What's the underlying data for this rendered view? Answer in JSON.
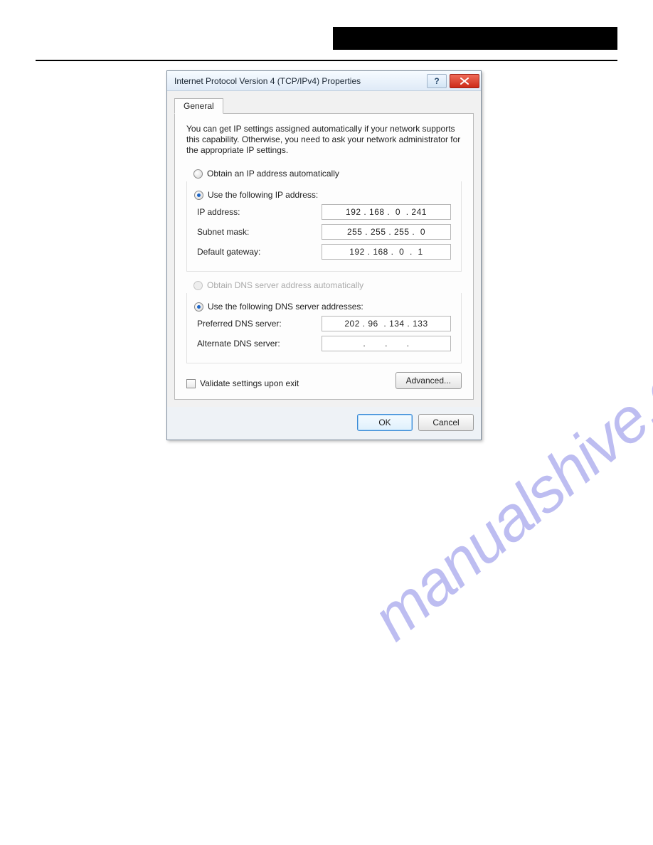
{
  "dialog": {
    "title": "Internet Protocol Version 4 (TCP/IPv4) Properties",
    "tab": "General",
    "intro": "You can get IP settings assigned automatically if your network supports this capability. Otherwise, you need to ask your network administrator for the appropriate IP settings.",
    "ip_section": {
      "auto_label": "Obtain an IP address automatically",
      "manual_label": "Use the following IP address:",
      "fields": {
        "ip_label": "IP address:",
        "ip_value": "192 . 168 .  0  . 241",
        "mask_label": "Subnet mask:",
        "mask_value": "255 . 255 . 255 .  0",
        "gw_label": "Default gateway:",
        "gw_value": "192 . 168 .  0  .  1"
      }
    },
    "dns_section": {
      "auto_label": "Obtain DNS server address automatically",
      "manual_label": "Use the following DNS server addresses:",
      "fields": {
        "pref_label": "Preferred DNS server:",
        "pref_value": "202 . 96  . 134 . 133",
        "alt_label": "Alternate DNS server:",
        "alt_value": ".       .       ."
      }
    },
    "validate_label": "Validate settings upon exit",
    "advanced_label": "Advanced...",
    "ok_label": "OK",
    "cancel_label": "Cancel",
    "help_symbol": "?"
  },
  "watermark": "manualshive.com"
}
